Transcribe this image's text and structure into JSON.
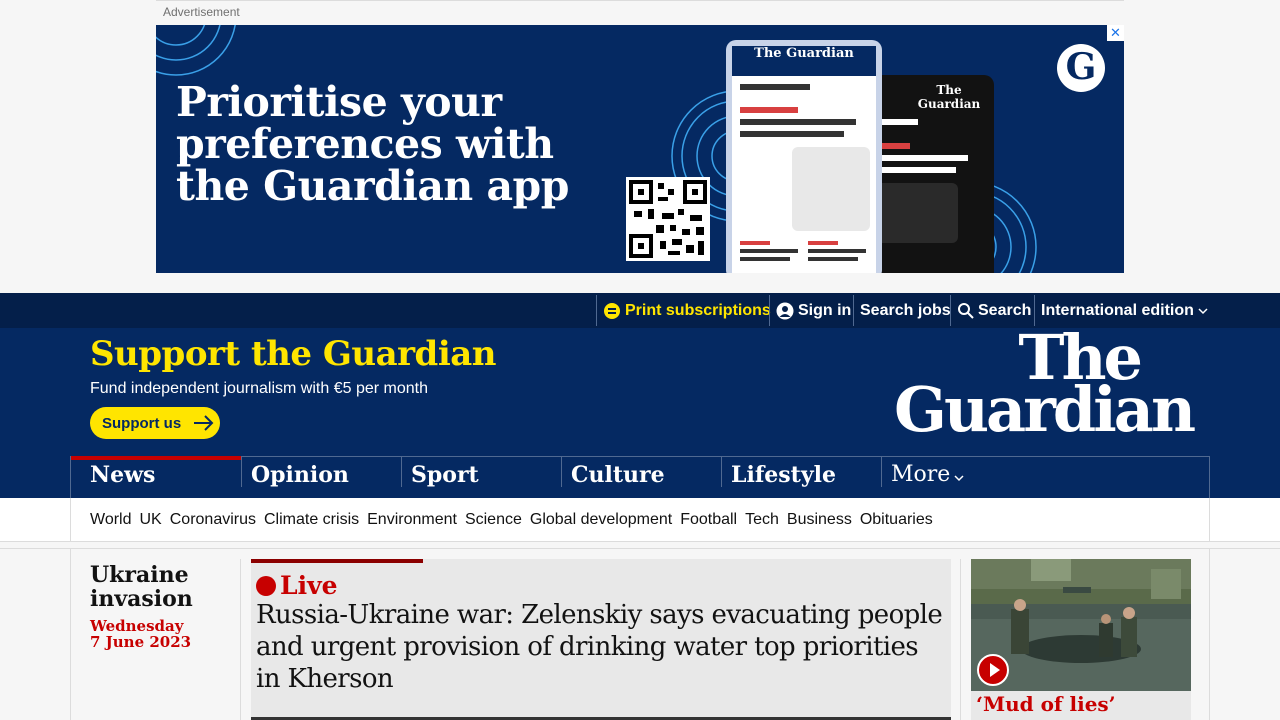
{
  "ad": {
    "label": "Advertisement",
    "headline": [
      "Prioritise your",
      "preferences with",
      "the Guardian app"
    ],
    "phone_brand": "The Guardian",
    "close_glyph": "✕"
  },
  "topbar": {
    "print_subscriptions": "Print subscriptions",
    "sign_in": "Sign in",
    "search_jobs": "Search jobs",
    "search": "Search",
    "edition": "International edition"
  },
  "masthead": {
    "support_title": "Support the Guardian",
    "support_subtitle": "Fund independent journalism with €5 per month",
    "support_button": "Support us",
    "logo_line1": "The",
    "logo_line2": "Guardian"
  },
  "nav": {
    "pillars": [
      "News",
      "Opinion",
      "Sport",
      "Culture",
      "Lifestyle",
      "More"
    ]
  },
  "subnav": {
    "links": [
      "World",
      "UK",
      "Coronavirus",
      "Climate crisis",
      "Environment",
      "Science",
      "Global development",
      "Football",
      "Tech",
      "Business",
      "Obituaries"
    ]
  },
  "content": {
    "section_title": "Ukraine invasion",
    "section_date_line1": "Wednesday",
    "section_date_line2": "7 June 2023",
    "live_label": "Live",
    "headline": "Russia-Ukraine war: Zelenskiy says evacuating people and urgent provision of drinking water top priorities in Kherson",
    "side_caption": "‘Mud of lies’"
  },
  "colors": {
    "brand_blue": "#052962",
    "topbar_blue": "#041f4a",
    "yellow": "#ffe500",
    "news_red": "#c70000"
  }
}
